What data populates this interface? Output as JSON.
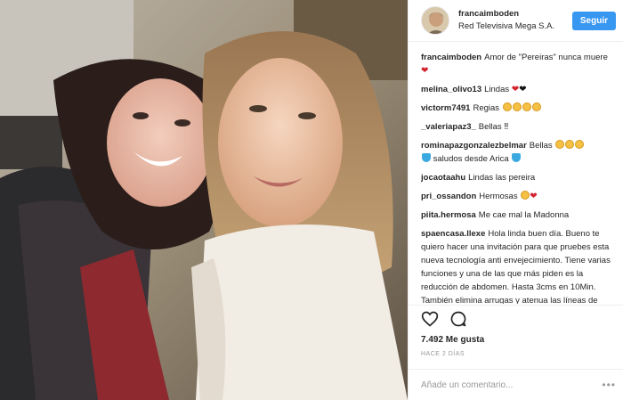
{
  "post": {
    "username": "francaimboden",
    "location": "Red Televisiva Mega S.A.",
    "follow_label": "Seguir"
  },
  "comments": [
    {
      "user": "francaimboden",
      "text": "Amor de \"Pereiras\" nunca muere"
    },
    {
      "user": "melina_olivo13",
      "text": "Lindas"
    },
    {
      "user": "victorm7491",
      "text": "Regias"
    },
    {
      "user": "_valeriapaz3_",
      "text": "Bellas"
    },
    {
      "user": "rominapazgonzalezbelmar",
      "text": "Bellas",
      "text2": "saludos desde Arica"
    },
    {
      "user": "jocaotaahu",
      "text": "Lindas las pereira"
    },
    {
      "user": "pri_ossandon",
      "text": "Hermosas"
    },
    {
      "user": "piita.hermosa",
      "text": "Me cae mal la Madonna"
    },
    {
      "user": "spaencasa.llexe",
      "text": "Hola linda buen día. Bueno te quiero hacer una invitación para que pruebes esta nueva tecnología anti envejecimiento. Tiene varias funciones y una de las que más piden es la reducción de abdomen. Hasta 3cms en 10Min. También elimina arrugas y atenua las líneas de exprecion. Esto es Completamente"
    }
  ],
  "actions": {
    "like_icon": "heart-outline-icon",
    "comment_icon": "comment-bubble-icon"
  },
  "likes_text": "7.492 Me gusta",
  "time_text": "HACE 2 DÍAS",
  "add_comment": {
    "placeholder": "Añade un comentario...",
    "more_label": "•••"
  },
  "colors": {
    "accent": "#3897f0",
    "text": "#262626",
    "muted": "#999999",
    "border": "#efefef"
  }
}
